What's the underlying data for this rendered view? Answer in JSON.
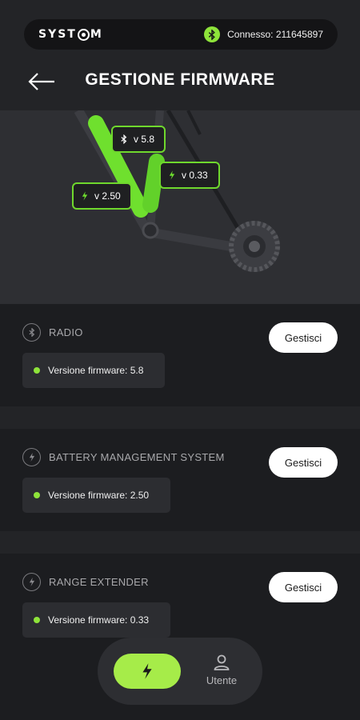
{
  "status": {
    "brand": "SYSTEM",
    "connection_text": "Connesso: 211645897",
    "accent_color": "#8ee33a"
  },
  "header": {
    "title": "GESTIONE FIRMWARE",
    "back_icon": "arrow-left-icon"
  },
  "hero": {
    "tags": [
      {
        "icon": "bluetooth-icon",
        "label": "v 5.8"
      },
      {
        "icon": "bolt-icon",
        "label": "v 0.33"
      },
      {
        "icon": "bolt-icon",
        "label": "v 2.50"
      }
    ]
  },
  "modules": [
    {
      "icon": "bluetooth-icon",
      "name": "RADIO",
      "firmware": "Versione firmware: 5.8",
      "button": "Gestisci"
    },
    {
      "icon": "bolt-icon",
      "name": "BATTERY MANAGEMENT SYSTEM",
      "firmware": "Versione firmware: 2.50",
      "button": "Gestisci"
    },
    {
      "icon": "bolt-icon",
      "name": "RANGE EXTENDER",
      "firmware": "Versione firmware: 0.33",
      "button": "Gestisci"
    }
  ],
  "nav": {
    "active_icon": "bolt-icon",
    "user_label": "Utente",
    "user_icon": "user-icon"
  }
}
